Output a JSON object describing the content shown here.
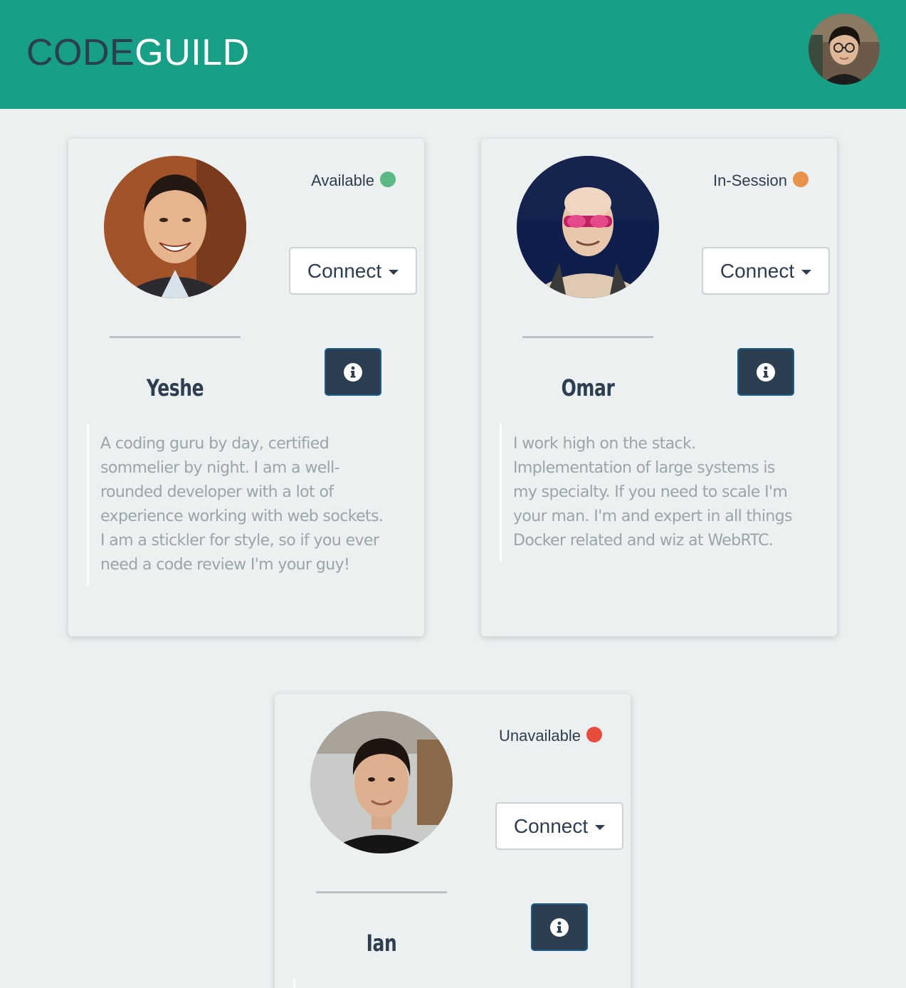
{
  "header": {
    "brand_part1": "CODE",
    "brand_part2": "GUILD",
    "bg_color": "#18a086"
  },
  "mentors": [
    {
      "name": "Yeshe",
      "status": "Available",
      "status_color": "#5cb884",
      "connect_label": "Connect",
      "bio": "A coding guru by day, certified sommelier by night. I am a well-rounded developer with a lot of experience working with web sockets. I am a stickler for style, so if you ever need a code review I'm your guy!"
    },
    {
      "name": "Omar",
      "status": "In-Session",
      "status_color": "#e8924a",
      "connect_label": "Connect",
      "bio": "I work high on the stack. Implementation of large systems is my specialty. If you need to scale I'm your man. I'm and expert in all things Docker related and wiz at WebRTC."
    },
    {
      "name": "Ian",
      "status": "Unavailable",
      "status_color": "#e74c3c",
      "connect_label": "Connect",
      "bio": ""
    }
  ]
}
